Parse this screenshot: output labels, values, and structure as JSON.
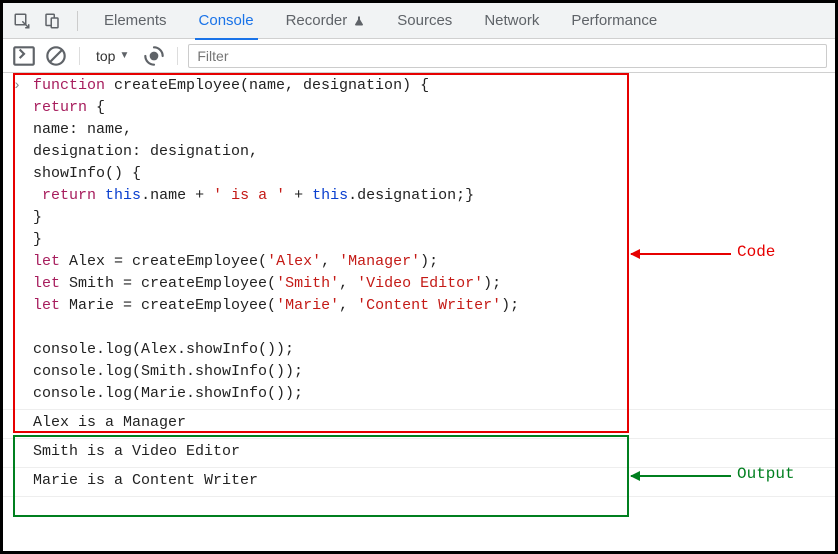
{
  "tabs": {
    "elements": "Elements",
    "console": "Console",
    "recorder": "Recorder",
    "sources": "Sources",
    "network": "Network",
    "performance": "Performance"
  },
  "toolbar": {
    "context": "top",
    "filter_placeholder": "Filter"
  },
  "code": {
    "l1_kw": "function",
    "l1_rest": " createEmployee(name, designation) {",
    "l2_kw": "return",
    "l2_rest": " {",
    "l3": "name: name,",
    "l4": "designation: designation,",
    "l5": "showInfo() {",
    "l6_pre": " ",
    "l6_kw1": "return",
    "l6_sp1": " ",
    "l6_this1": "this",
    "l6_mid1": ".name + ",
    "l6_str": "' is a '",
    "l6_mid2": " + ",
    "l6_this2": "this",
    "l6_end": ".designation;}",
    "l7": "}",
    "l8": "}",
    "l9_kw": "let",
    "l9_mid": " Alex = createEmployee(",
    "l9_s1": "'Alex'",
    "l9_c": ", ",
    "l9_s2": "'Manager'",
    "l9_end": ");",
    "l10_kw": "let",
    "l10_mid": " Smith = createEmployee(",
    "l10_s1": "'Smith'",
    "l10_c": ", ",
    "l10_s2": "'Video Editor'",
    "l10_end": ");",
    "l11_kw": "let",
    "l11_mid": " Marie = createEmployee(",
    "l11_s1": "'Marie'",
    "l11_c": ", ",
    "l11_s2": "'Content Writer'",
    "l11_end": ");",
    "l13": "console.log(Alex.showInfo());",
    "l14": "console.log(Smith.showInfo());",
    "l15": "console.log(Marie.showInfo());"
  },
  "output": {
    "o1": "Alex is a Manager",
    "o2": "Smith is a Video Editor",
    "o3": "Marie is a Content Writer"
  },
  "annotations": {
    "code_label": "Code",
    "output_label": "Output"
  }
}
